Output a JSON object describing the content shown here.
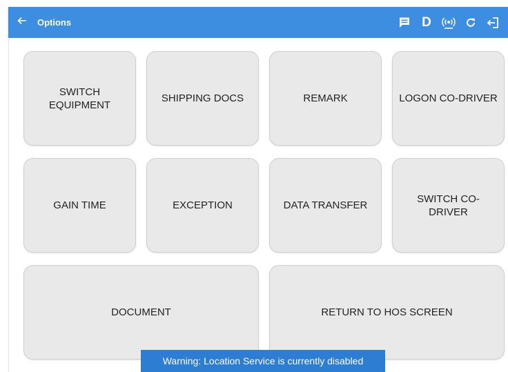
{
  "app": {
    "title": "Options"
  },
  "toolbar": {
    "icons": [
      "back-arrow-icon",
      "message-icon",
      "d-icon",
      "broadcast-icon",
      "refresh-icon",
      "logout-icon"
    ],
    "d_label": "D",
    "accent": "#3d8ee0"
  },
  "buttons": {
    "switch_equipment": "SWITCH EQUIPMENT",
    "shipping_docs": "SHIPPING DOCS",
    "remark": "REMARK",
    "logon_co_driver": "LOGON CO-DRIVER",
    "gain_time": "GAIN TIME",
    "exception": "EXCEPTION",
    "data_transfer": "DATA TRANSFER",
    "switch_co_driver": "SWITCH CO-DRIVER",
    "document": "DOCUMENT",
    "return_to_hos": "RETURN TO HOS SCREEN"
  },
  "snackbar": {
    "message": "Warning: Location Service is currently disabled",
    "color": "#2d7dd3"
  }
}
